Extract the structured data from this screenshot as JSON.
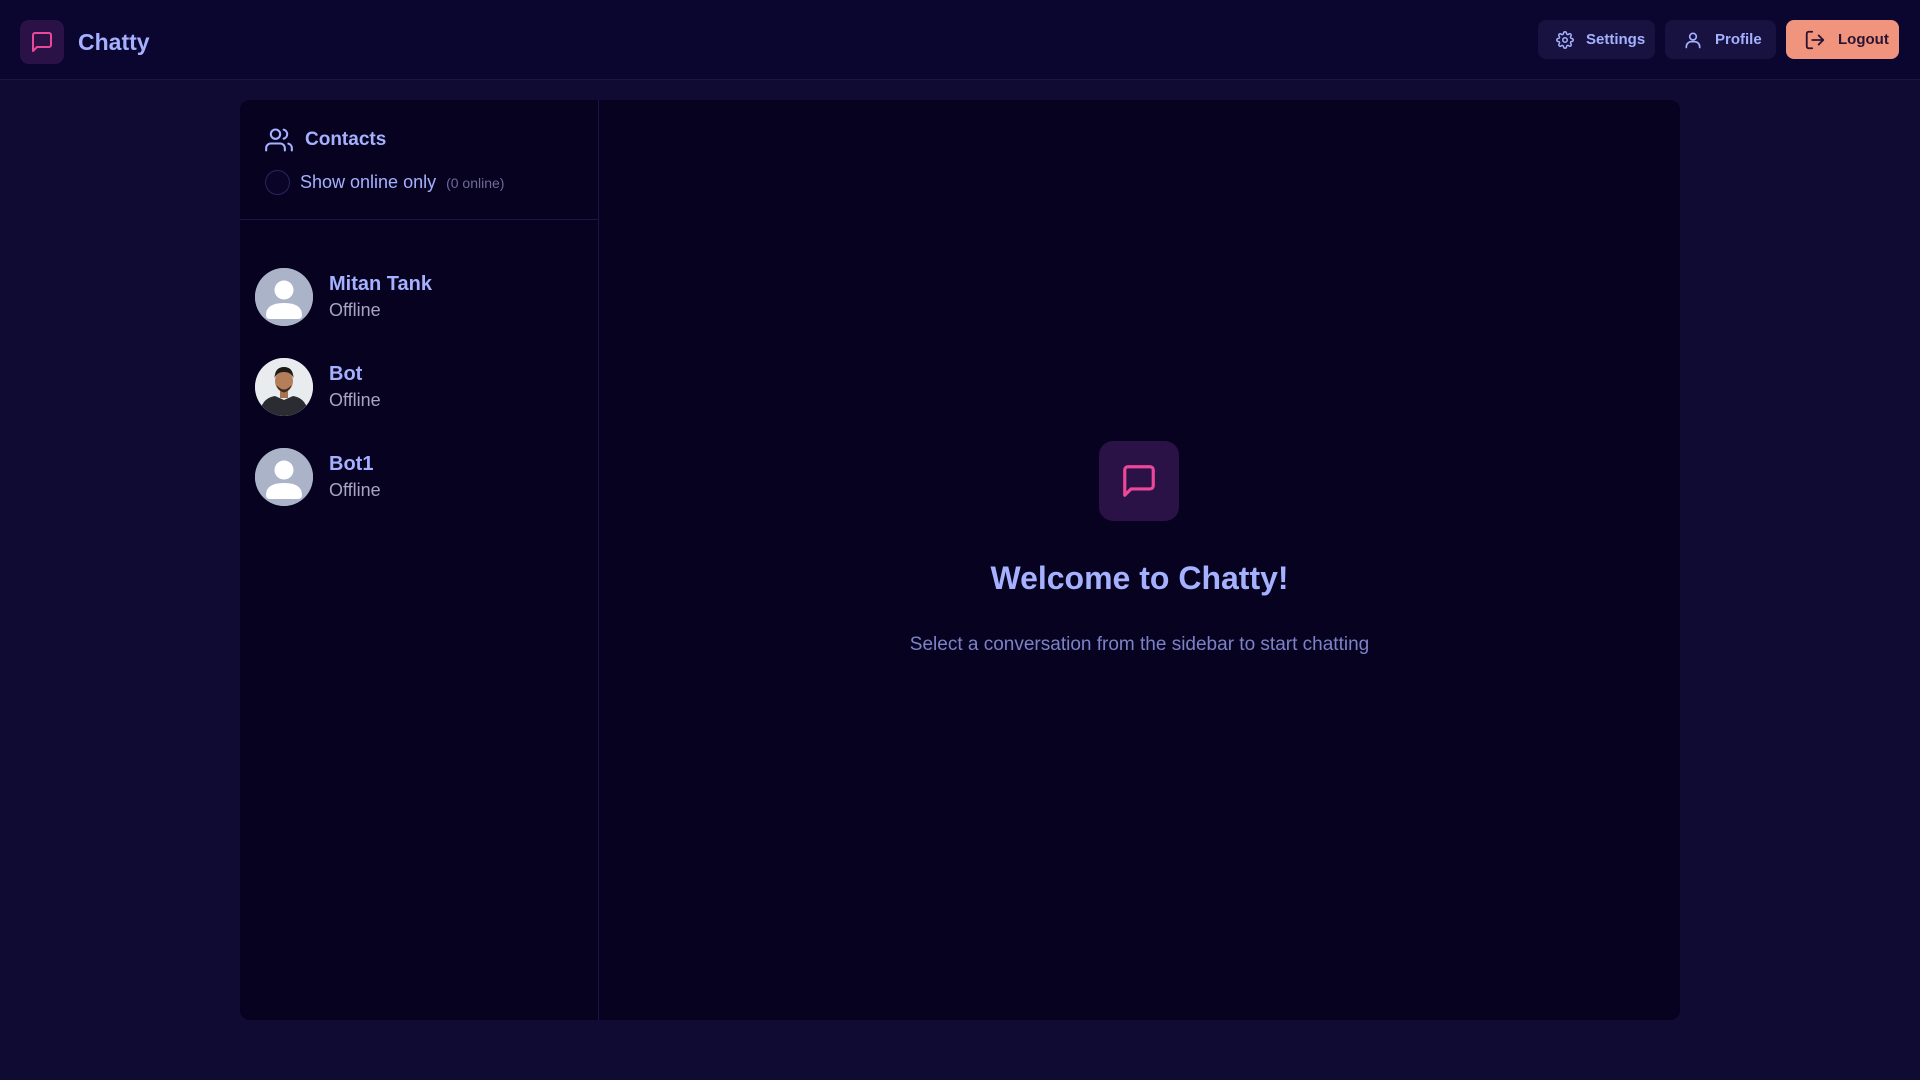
{
  "app": {
    "name": "Chatty"
  },
  "nav": {
    "settings_label": "Settings",
    "profile_label": "Profile",
    "logout_label": "Logout"
  },
  "sidebar": {
    "title": "Contacts",
    "filter_label": "Show online only",
    "online_count": "(0 online)",
    "contacts": [
      {
        "name": "Mitan Tank",
        "status": "Offline",
        "avatar": "default-avatar"
      },
      {
        "name": "Bot",
        "status": "Offline",
        "avatar": "photo-avatar"
      },
      {
        "name": "Bot1",
        "status": "Offline",
        "avatar": "default-avatar"
      }
    ]
  },
  "main": {
    "welcome_title": "Welcome to Chatty!",
    "welcome_subtitle": "Select a conversation from the sidebar to start chatting"
  },
  "colors": {
    "accent": "#ec4899",
    "primary_text": "#a5b1ff",
    "logout_bg": "#f0947e",
    "background": "#0f0b33"
  },
  "icons": {
    "logo": "message-square-icon",
    "settings": "gear-icon",
    "profile": "user-icon",
    "logout": "logout-icon",
    "contacts": "users-icon"
  }
}
